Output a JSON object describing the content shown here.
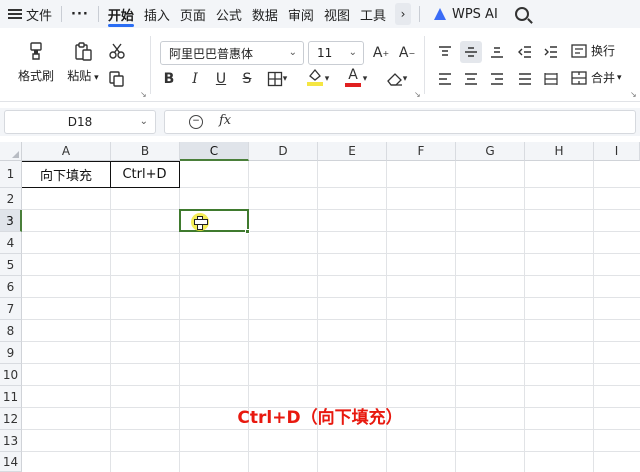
{
  "menubar": {
    "file": "文件",
    "more": "···",
    "tabs": [
      "开始",
      "插入",
      "页面",
      "公式",
      "数据",
      "审阅",
      "视图",
      "工具"
    ],
    "active_tab": "开始",
    "scroll_right": "›",
    "wps_ai": "WPS AI"
  },
  "ribbon": {
    "format_painter": "格式刷",
    "paste": "粘贴",
    "cut_icon": "scissors-icon",
    "font_name": "阿里巴巴普惠体",
    "font_size": "11",
    "bold": "B",
    "italic": "I",
    "underline": "U",
    "strikethrough": "S",
    "font_color_letter": "A",
    "wrap_text": "换行",
    "merge": "合并",
    "accent_color": "#2a6df4",
    "font_color": "#e02020",
    "highlight_color": "#f5e642"
  },
  "formula_bar": {
    "name_box": "D18",
    "fx": "fx",
    "formula": ""
  },
  "sheet": {
    "columns": [
      "A",
      "B",
      "C",
      "D",
      "E",
      "F",
      "G",
      "H",
      "I"
    ],
    "selected_column": "C",
    "rows": [
      "1",
      "2",
      "3",
      "4",
      "5",
      "6",
      "7",
      "8",
      "9",
      "10",
      "11",
      "12",
      "13",
      "14"
    ],
    "selected_row": "3",
    "cells": {
      "A1": "向下填充",
      "B1": "Ctrl+D"
    },
    "active_cell": "C3",
    "selection_color": "#3f7a2e"
  },
  "caption": "Ctrl+D（向下填充）",
  "caption_color": "#e8190f"
}
